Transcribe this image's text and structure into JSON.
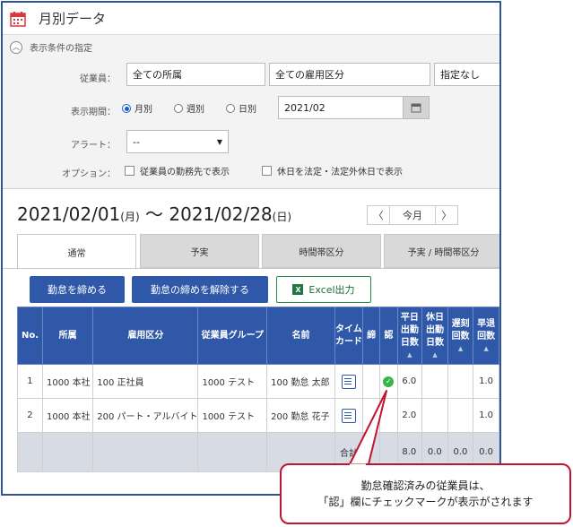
{
  "title": "月別データ",
  "conditions": {
    "header": "表示条件の指定",
    "employee_label": "従業員：",
    "employee_dept": "全ての所属",
    "employee_type": "全ての雇用区分",
    "employee_extra": "指定なし",
    "period_label": "表示期間：",
    "period_options": [
      "月別",
      "週別",
      "日別"
    ],
    "period_selected": "月別",
    "period_value": "2021/02",
    "alert_label": "アラート：",
    "alert_value": "--",
    "option_label": "オプション：",
    "option_checks": [
      "従業員の勤務先で表示",
      "休日を法定・法定外休日で表示"
    ]
  },
  "period": {
    "start": "2021/02/01",
    "start_dow": "(月)",
    "sep": "〜",
    "end": "2021/02/28",
    "end_dow": "(日)",
    "prev": "〈",
    "current": "今月",
    "next": "〉"
  },
  "tabs": [
    "通常",
    "予実",
    "時間帯区分",
    "予実 / 時間帯区分"
  ],
  "active_tab": "通常",
  "buttons": {
    "close": "勤怠を締める",
    "unclose": "勤怠の締めを解除する",
    "excel": "Excel出力"
  },
  "table": {
    "headers": {
      "no": "No.",
      "dept": "所属",
      "type": "雇用区分",
      "group": "従業員グループ",
      "name": "名前",
      "timecard_1": "タイム",
      "timecard_2": "カード",
      "closed": "締",
      "approved": "認",
      "weekday_1": "平日",
      "weekday_2": "出勤",
      "weekday_3": "日数",
      "holiday_1": "休日",
      "holiday_2": "出勤",
      "holiday_3": "日数",
      "late_1": "遅刻",
      "late_2": "回数",
      "early_1": "早退",
      "early_2": "回数"
    },
    "rows": [
      {
        "no": "1",
        "dept": "1000 本社",
        "type": "100 正社員",
        "group": "1000 テスト",
        "name": "100 勤怠 太郎",
        "approved": true,
        "weekday": "6.0",
        "holiday": "",
        "late": "",
        "early": "1.0"
      },
      {
        "no": "2",
        "dept": "1000 本社",
        "type": "200 パート・アルバイト",
        "group": "1000 テスト",
        "name": "200 勤怠 花子",
        "approved": false,
        "weekday": "2.0",
        "holiday": "",
        "late": "",
        "early": "1.0"
      }
    ],
    "total": {
      "label": "合計",
      "weekday": "8.0",
      "holiday": "0.0",
      "late": "0.0",
      "early": "0.0"
    }
  },
  "callout": {
    "line1": "勤怠確認済みの従業員は、",
    "line2": "「認」欄にチェックマークが表示がされます"
  },
  "colors": {
    "primary": "#2f58a8",
    "frame": "#2f5597",
    "callout_border": "#c0152f",
    "check": "#3bb54a"
  }
}
